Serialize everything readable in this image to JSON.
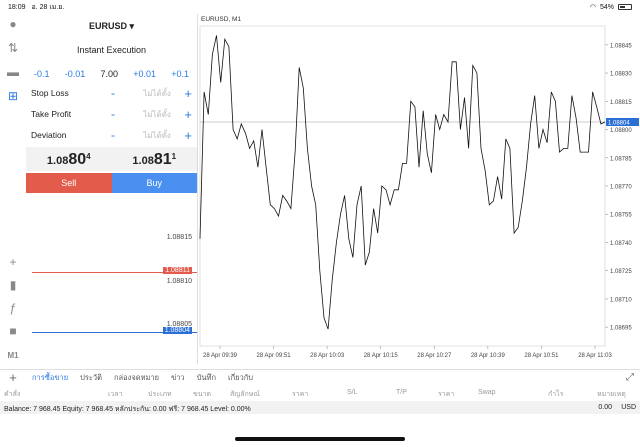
{
  "status": {
    "time": "18:09",
    "date": "อ. 28 เม.ย.",
    "battery": "54%",
    "battery_level": 0.54
  },
  "order": {
    "symbol": "EURUSD",
    "mode": "Instant Execution",
    "volume": {
      "m1": "-0.1",
      "m2": "-0.01",
      "value": "7.00",
      "p1": "+0.01",
      "p2": "+0.1"
    },
    "stop_loss": {
      "label": "Stop Loss",
      "placeholder": "ไม่ได้ตั้ง"
    },
    "take_profit": {
      "label": "Take Profit",
      "placeholder": "ไม่ได้ตั้ง"
    },
    "deviation": {
      "label": "Deviation",
      "placeholder": "ไม่ได้ตั้ง"
    },
    "bid": {
      "a": "1.08",
      "b": "80",
      "c": "4"
    },
    "ask": {
      "a": "1.08",
      "b": "81",
      "c": "1"
    },
    "sell_label": "Sell",
    "buy_label": "Buy"
  },
  "left_levels": {
    "l1": "1.08815",
    "l2": "1.08810",
    "l3": "1.08805",
    "sell_line": "1.08811",
    "buy_line": "1.08804"
  },
  "chart_data": {
    "type": "line",
    "title": "EURUSD, M1",
    "y_ticks": [
      "1.08845",
      "1.08830",
      "1.08815",
      "1.08800",
      "1.08785",
      "1.08770",
      "1.08755",
      "1.08740",
      "1.08725",
      "1.08710",
      "1.08695"
    ],
    "ylim": [
      1.08685,
      1.08855
    ],
    "x_ticks": [
      "28 Apr 09:39",
      "28 Apr 09:51",
      "28 Apr 10:03",
      "28 Apr 10:15",
      "28 Apr 10:27",
      "28 Apr 10:39",
      "28 Apr 10:51",
      "28 Apr 11:03"
    ],
    "current_price": "1.08804",
    "series": [
      {
        "values": [
          1.08742,
          1.0882,
          1.08808,
          1.0884,
          1.0885,
          1.08825,
          1.08848,
          1.08844,
          1.088,
          1.08795,
          1.08803,
          1.08798,
          1.0879,
          1.08794,
          1.0878,
          1.088,
          1.0878,
          1.0876,
          1.08758,
          1.08754,
          1.08765,
          1.08762,
          1.08758,
          1.08788,
          1.08833,
          1.08822,
          1.0879,
          1.0877,
          1.0876,
          1.08725,
          1.087,
          1.08694,
          1.0872,
          1.0874,
          1.08755,
          1.08765,
          1.08742,
          1.08732,
          1.0876,
          1.0877,
          1.08728,
          1.08735,
          1.08758,
          1.08745,
          1.0877,
          1.08768,
          1.0876,
          1.08768,
          1.08768,
          1.08782,
          1.08782,
          1.08815,
          1.08812,
          1.0878,
          1.0881,
          1.08787,
          1.08777,
          1.08808,
          1.088,
          1.08808,
          1.08804,
          1.08836,
          1.08836,
          1.088,
          1.08817,
          1.0879,
          1.08834,
          1.0883,
          1.0879,
          1.08778,
          1.0876,
          1.08762,
          1.08775,
          1.08763,
          1.08795,
          1.0879,
          1.08745,
          1.08748,
          1.08762,
          1.0878,
          1.08803,
          1.08818,
          1.0879,
          1.088,
          1.08793,
          1.0882,
          1.08815,
          1.08788,
          1.0879,
          1.0879,
          1.08818,
          1.08806,
          1.08788,
          1.08788,
          1.08788,
          1.0882,
          1.08812,
          1.08803,
          1.08804
        ]
      }
    ]
  },
  "tabs": [
    "การซื้อขาย",
    "ประวัติ",
    "กล่องจดหมาย",
    "ข่าว",
    "บันทึก",
    "เกี่ยวกับ"
  ],
  "columns": [
    "คำสั่ง",
    "เวลา",
    "ประเภท",
    "ขนาด",
    "สัญลักษณ์",
    "ราคา",
    "S/L",
    "T/P",
    "ราคา",
    "Swap",
    "กำไร",
    "หมายเหตุ"
  ],
  "balance": {
    "text": "Balance: 7 968.45 Equity: 7 968.45 หลักประกัน: 0.00 ฟรี: 7 968.45 Level: 0.00%",
    "profit": "0.00",
    "currency": "USD"
  }
}
